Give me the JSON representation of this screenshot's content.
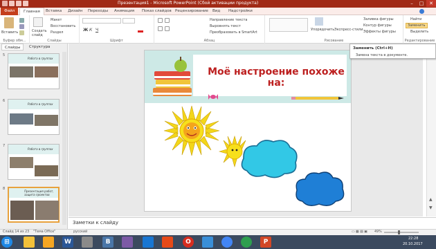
{
  "title": "Презентация1 - Microsoft PowerPoint (Сбой активации продукта)",
  "tabs": [
    "Файл",
    "Главная",
    "Вставка",
    "Дизайн",
    "Переходы",
    "Анимация",
    "Показ слайдов",
    "Рецензирование",
    "Вид",
    "Надстройки"
  ],
  "ribbon": {
    "paste": "Вставить",
    "create_slide": "Создать слайд",
    "cut": "Макет",
    "restore": "Восстановить",
    "section": "Раздел",
    "text_dir": "Направление текста",
    "align_text": "Выровнять текст",
    "smartart": "Преобразовать в SmartArt",
    "arrange": "Упорядочить",
    "quick_styles": "Экспресс-стили",
    "fill": "Заливка фигуры",
    "outline": "Контур фигуры",
    "effects": "Эффекты фигуры",
    "find": "Найти",
    "replace": "Заменить",
    "select": "Выделить",
    "groups": [
      "Буфер обм...",
      "Слайды",
      "Шрифт",
      "Абзац",
      "Рисование",
      "Редактирование"
    ]
  },
  "tooltip": {
    "title": "Заменить (Ctrl+H)",
    "body": "Замена текста в документе."
  },
  "panel_tabs": [
    "Слайды",
    "Структура"
  ],
  "thumbs": [
    {
      "num": "5",
      "title": "Работа в группах"
    },
    {
      "num": "6",
      "title": "Работа в группах"
    },
    {
      "num": "7",
      "title": "Работа в группах"
    },
    {
      "num": "8",
      "title": "Презентация работ, защита проектов"
    }
  ],
  "slide": {
    "title": "Моё настроение похоже на:"
  },
  "notes": "Заметки к слайду",
  "status": {
    "slide": "Слайд 14 из 23",
    "theme": "\"Тема Office\"",
    "lang": "русский",
    "zoom": "49%"
  },
  "clock": {
    "time": "22:28",
    "date": "20.10.2017"
  },
  "colors": {
    "titlebar": "#a12a16",
    "file_tab": "#c43e1c",
    "slide_title": "#bd2020",
    "sun": "#f3e21a",
    "cloud1": "#32c8e6",
    "cloud2": "#1f7fd6"
  }
}
